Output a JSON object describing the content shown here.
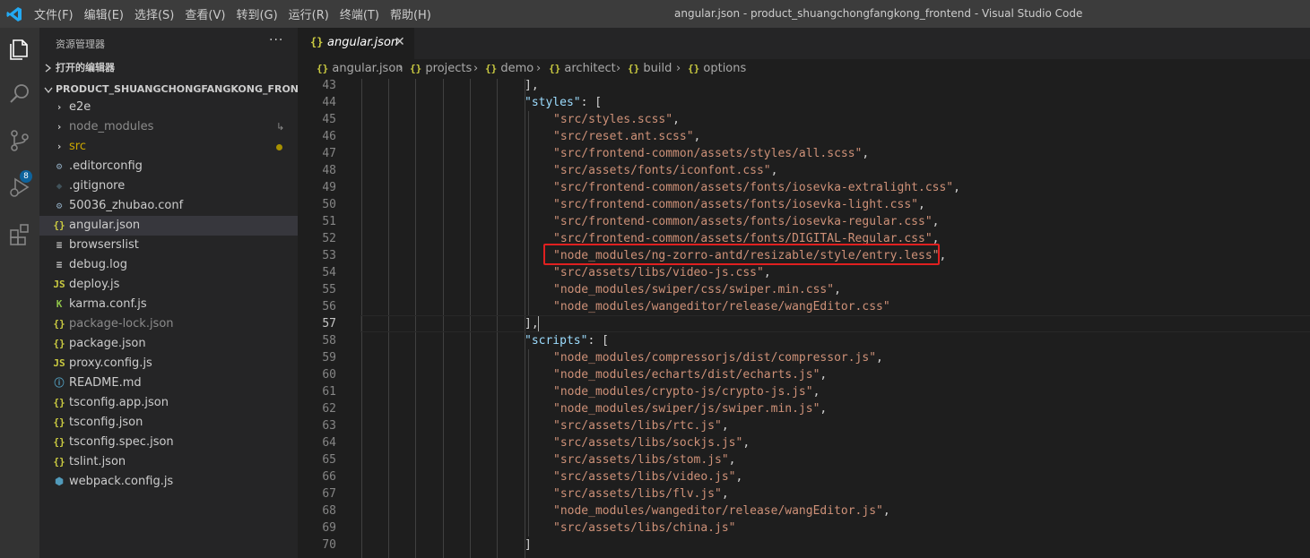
{
  "app": {
    "logo_icon": "vscode-logo-icon",
    "window_title": "angular.json - product_shuangchongfangkong_frontend - Visual Studio Code",
    "menu": [
      "文件(F)",
      "编辑(E)",
      "选择(S)",
      "查看(V)",
      "转到(G)",
      "运行(R)",
      "终端(T)",
      "帮助(H)"
    ]
  },
  "activity_bar": {
    "icons": [
      "explorer-icon",
      "search-icon",
      "source-control-icon",
      "run-debug-icon",
      "extensions-icon"
    ],
    "scm_badge": "8"
  },
  "sidebar": {
    "title": "资源管理器",
    "more": "···",
    "open_editors_label": "打开的编辑器",
    "project_label": "PRODUCT_SHUANGCHONGFANGKONG_FRONTEND",
    "items": [
      {
        "name": "e2e",
        "icon": "›",
        "type": "folder"
      },
      {
        "name": "node_modules",
        "icon": "›",
        "type": "folder"
      },
      {
        "name": "src",
        "icon": "›",
        "type": "folder"
      },
      {
        "name": ".editorconfig",
        "icon": "⚙",
        "type": "gear"
      },
      {
        "name": ".gitignore",
        "icon": "◆",
        "type": "git"
      },
      {
        "name": "50036_zhubao.conf",
        "icon": "⚙",
        "type": "gear"
      },
      {
        "name": "angular.json",
        "icon": "{}",
        "type": "json"
      },
      {
        "name": "browserslist",
        "icon": "≡",
        "type": "text"
      },
      {
        "name": "debug.log",
        "icon": "≡",
        "type": "text"
      },
      {
        "name": "deploy.js",
        "icon": "JS",
        "type": "js"
      },
      {
        "name": "karma.conf.js",
        "icon": "K",
        "type": "karma"
      },
      {
        "name": "package-lock.json",
        "icon": "{}",
        "type": "json"
      },
      {
        "name": "package.json",
        "icon": "{}",
        "type": "json"
      },
      {
        "name": "proxy.config.js",
        "icon": "JS",
        "type": "js"
      },
      {
        "name": "README.md",
        "icon": "ⓘ",
        "type": "info"
      },
      {
        "name": "tsconfig.app.json",
        "icon": "{}",
        "type": "json"
      },
      {
        "name": "tsconfig.json",
        "icon": "{}",
        "type": "json"
      },
      {
        "name": "tsconfig.spec.json",
        "icon": "{}",
        "type": "json"
      },
      {
        "name": "tslint.json",
        "icon": "{}",
        "type": "json"
      },
      {
        "name": "webpack.config.js",
        "icon": "⬢",
        "type": "webpack"
      }
    ]
  },
  "tab": {
    "icon": "{}",
    "label": "angular.json",
    "close": "✕"
  },
  "breadcrumb": [
    {
      "icon": "{}",
      "label": "angular.json"
    },
    {
      "icon": "{}",
      "label": "projects"
    },
    {
      "icon": "{}",
      "label": "demo"
    },
    {
      "icon": "{}",
      "label": "architect"
    },
    {
      "icon": "{}",
      "label": "build"
    },
    {
      "icon": "{}",
      "label": "options"
    }
  ],
  "editor": {
    "current_line": "57",
    "lines": [
      {
        "no": "43",
        "indent": 0,
        "key": "",
        "str": "",
        "tail": "],"
      },
      {
        "no": "44",
        "indent": 0,
        "key": "\"styles\"",
        "str": "",
        "tail": ": ["
      },
      {
        "no": "45",
        "indent": 1,
        "key": "",
        "str": "\"src/styles.scss\"",
        "tail": ","
      },
      {
        "no": "46",
        "indent": 1,
        "key": "",
        "str": "\"src/reset.ant.scss\"",
        "tail": ","
      },
      {
        "no": "47",
        "indent": 1,
        "key": "",
        "str": "\"src/frontend-common/assets/styles/all.scss\"",
        "tail": ","
      },
      {
        "no": "48",
        "indent": 1,
        "key": "",
        "str": "\"src/assets/fonts/iconfont.css\"",
        "tail": ","
      },
      {
        "no": "49",
        "indent": 1,
        "key": "",
        "str": "\"src/frontend-common/assets/fonts/iosevka-extralight.css\"",
        "tail": ","
      },
      {
        "no": "50",
        "indent": 1,
        "key": "",
        "str": "\"src/frontend-common/assets/fonts/iosevka-light.css\"",
        "tail": ","
      },
      {
        "no": "51",
        "indent": 1,
        "key": "",
        "str": "\"src/frontend-common/assets/fonts/iosevka-regular.css\"",
        "tail": ","
      },
      {
        "no": "52",
        "indent": 1,
        "key": "",
        "str": "\"src/frontend-common/assets/fonts/DIGITAL-Regular.css\"",
        "tail": ","
      },
      {
        "no": "53",
        "indent": 1,
        "key": "",
        "str": "\"node_modules/ng-zorro-antd/resizable/style/entry.less\"",
        "tail": ","
      },
      {
        "no": "54",
        "indent": 1,
        "key": "",
        "str": "\"src/assets/libs/video-js.css\"",
        "tail": ","
      },
      {
        "no": "55",
        "indent": 1,
        "key": "",
        "str": "\"node_modules/swiper/css/swiper.min.css\"",
        "tail": ","
      },
      {
        "no": "56",
        "indent": 1,
        "key": "",
        "str": "\"node_modules/wangeditor/release/wangEditor.css\"",
        "tail": ""
      },
      {
        "no": "57",
        "indent": 0,
        "key": "",
        "str": "",
        "tail": "],"
      },
      {
        "no": "58",
        "indent": 0,
        "key": "\"scripts\"",
        "str": "",
        "tail": ": ["
      },
      {
        "no": "59",
        "indent": 1,
        "key": "",
        "str": "\"node_modules/compressorjs/dist/compressor.js\"",
        "tail": ","
      },
      {
        "no": "60",
        "indent": 1,
        "key": "",
        "str": "\"node_modules/echarts/dist/echarts.js\"",
        "tail": ","
      },
      {
        "no": "61",
        "indent": 1,
        "key": "",
        "str": "\"node_modules/crypto-js/crypto-js.js\"",
        "tail": ","
      },
      {
        "no": "62",
        "indent": 1,
        "key": "",
        "str": "\"node_modules/swiper/js/swiper.min.js\"",
        "tail": ","
      },
      {
        "no": "63",
        "indent": 1,
        "key": "",
        "str": "\"src/assets/libs/rtc.js\"",
        "tail": ","
      },
      {
        "no": "64",
        "indent": 1,
        "key": "",
        "str": "\"src/assets/libs/sockjs.js\"",
        "tail": ","
      },
      {
        "no": "65",
        "indent": 1,
        "key": "",
        "str": "\"src/assets/libs/stom.js\"",
        "tail": ","
      },
      {
        "no": "66",
        "indent": 1,
        "key": "",
        "str": "\"src/assets/libs/video.js\"",
        "tail": ","
      },
      {
        "no": "67",
        "indent": 1,
        "key": "",
        "str": "\"src/assets/libs/flv.js\"",
        "tail": ","
      },
      {
        "no": "68",
        "indent": 1,
        "key": "",
        "str": "\"node_modules/wangeditor/release/wangEditor.js\"",
        "tail": ","
      },
      {
        "no": "69",
        "indent": 1,
        "key": "",
        "str": "\"src/assets/libs/china.js\"",
        "tail": ""
      },
      {
        "no": "70",
        "indent": 0,
        "key": "",
        "str": "",
        "tail": "]"
      }
    ]
  },
  "colors": {
    "accent": "#007acc",
    "json_key": "#9cdcfe",
    "json_string": "#ce9178",
    "highlight_box": "#e02020",
    "modified": "#cca700"
  }
}
